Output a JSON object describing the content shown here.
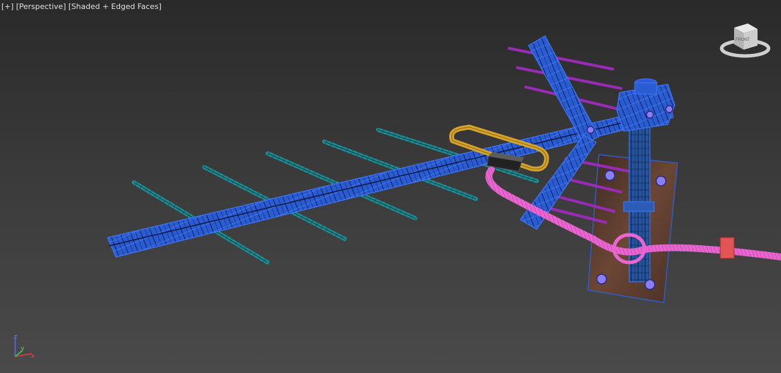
{
  "viewport": {
    "menu_label": "[+]",
    "view_label": "[Perspective]",
    "shading_label": "[Shaded + Edged Faces]"
  },
  "viewcube": {
    "face_label": "FRONT"
  },
  "axis_tripod": {
    "x": "x",
    "y": "y",
    "z": "z"
  },
  "colors": {
    "boom": "#2c5fd6",
    "director": "#17a3a8",
    "reflector": "#9a2bb6",
    "dipole": "#d8a62a",
    "cable": "#e96bd2",
    "plate": "#5e3b2c",
    "mast": "#1f4fa8",
    "bolt": "#8a7ef4",
    "clip": "#e25555"
  }
}
